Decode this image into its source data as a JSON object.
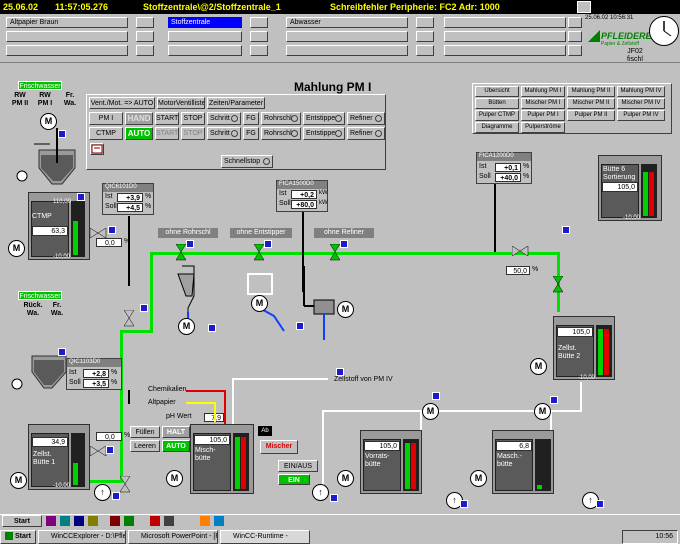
{
  "header": {
    "date": "25.06.02",
    "time": "11:57:05.276",
    "location": "Stoffzentrale\\@2/Stoffzentrale_1",
    "error": "Schreibfehler Peripherie: FC2 Adr: 1000",
    "clock_text": "25.06.02 10:56:31"
  },
  "areas": [
    "Altpapier Braun",
    "Stoffzentrale",
    "Abwasser"
  ],
  "brand": {
    "logo": "PFLEIDERER",
    "sub": "Papier & Zellstoff",
    "station": "JF02",
    "user": "fischl"
  },
  "title": "Mahlung PM I",
  "control_panel": {
    "headers": [
      "Vent./Mot. => AUTO",
      "MotorVentilliste",
      "Zeiten/Parameter"
    ],
    "row1": {
      "label": "PM I",
      "mode": "HAND",
      "start": "START",
      "stop": "STOP",
      "schritt": "Schritt",
      "fg": "FG",
      "r1": "Rohrschl",
      "r2": "Entstipper",
      "r3": "Refiner"
    },
    "row2": {
      "label": "CTMP",
      "mode": "AUTO",
      "start": "START",
      "stop": "STOP",
      "schritt": "Schritt",
      "fg": "FG",
      "r1": "Rohrschl",
      "r2": "Entstipper",
      "r3": "Refiner"
    },
    "schnellstop": "Schnellstop"
  },
  "nav_buttons": [
    [
      "Übersicht",
      "Mahlung PM I",
      "Mahlung PM II",
      "Mahlung PM IV"
    ],
    [
      "Bütten",
      "Mischer PM I",
      "Mischer PM II",
      "Mischer PM IV"
    ],
    [
      "Pulper CTMP",
      "Pulper PM I",
      "Pulper PM II",
      "Pulper PM IV"
    ],
    [
      "Diagramme",
      "Pulperströme",
      "",
      ""
    ]
  ],
  "frischwasser_top": {
    "label": "Frischwasser",
    "cols": [
      "RW\nPM II",
      "RW\nPM I",
      "Fr.\nWa."
    ]
  },
  "frischwasser_bot": {
    "label": "Frischwasser",
    "cols": [
      "Rück.\nWa.",
      "Fr.\nWa."
    ]
  },
  "ctrl_qic1": {
    "tag": "QIC6101D0",
    "ist_label": "Ist",
    "ist": "+3,9",
    "soll_label": "Soll",
    "soll": "+4,5",
    "unit": "%"
  },
  "ctrl_fica": {
    "tag": "FICA1500D0",
    "ist_label": "Ist",
    "ist": "+0,2",
    "soll_label": "Soll",
    "soll": "+80,0",
    "u1": "kW",
    "u2": "kW"
  },
  "ctrl_fica2": {
    "tag": "FICA1200D0",
    "ist_label": "Ist",
    "ist": "+0,1",
    "soll_label": "Soll",
    "soll": "+40,0",
    "unit": "%"
  },
  "ctrl_qic2": {
    "tag": "QIC1103D0",
    "ist_label": "Ist",
    "ist": "+2,8",
    "soll_label": "Soll",
    "soll": "+3,5",
    "unit": "%"
  },
  "tanks": {
    "ctmp": {
      "label": "CTMP",
      "value": "63,3",
      "max": "110,00",
      "min": "-10,00"
    },
    "zellst1": {
      "label": "Zellst.\nBütte 1",
      "value": "34,9",
      "max": "110,00",
      "min": "-10,00"
    },
    "misch": {
      "label": "Misch-\nbütte",
      "value": "105,0",
      "max": "110,00",
      "min": "-10,00"
    },
    "vorrat": {
      "label": "Vorrats-\nbütte",
      "value": "105,0",
      "max": "110,00",
      "min": "-10,00"
    },
    "masch": {
      "label": "Masch.-\nbütte",
      "value": "6,8",
      "max": "110,00",
      "min": "-10,00"
    },
    "zellst2": {
      "label": "Zellst.\nBütte 2",
      "value": "105,0",
      "max": "110,00",
      "min": "-10,00"
    },
    "butte6": {
      "label": "Bütte 6\nSortierung",
      "value": "105,0",
      "max": "110,00",
      "min": "-10,00"
    }
  },
  "bypass": [
    {
      "label": "ohne Rohrschl"
    },
    {
      "label": "ohne Entstipper"
    },
    {
      "label": "ohne Refiner"
    }
  ],
  "valve_pct": [
    "0,0",
    "0,0",
    "50,0"
  ],
  "misc": {
    "chemikalien": "Chemikalien",
    "altpapier": "Altpapier",
    "zellstoff": "Zellstoff von PM IV",
    "phwert_label": "pH Wert",
    "phwert": "7,9",
    "fuellen": "Füllen",
    "halt": "HALT",
    "leeren": "Leeren",
    "auto": "AUTO",
    "mischer": "Mischer",
    "ein_aus": "EIN/AUS",
    "ein": "EIN",
    "ab": "Ab"
  },
  "taskbar": {
    "start": "Start",
    "items": [
      "WinCCExplorer - D:\\Pfleid...",
      "Microsoft PowerPoint - [Pfei...",
      "WinCC-Runtime -"
    ],
    "time": "10:56"
  },
  "colors": {
    "pipe_green": "#00e000",
    "pipe_blue": "#1040ff",
    "header_bg": "#000000",
    "header_fg": "#ffff00",
    "auto_green": "#00c000"
  }
}
